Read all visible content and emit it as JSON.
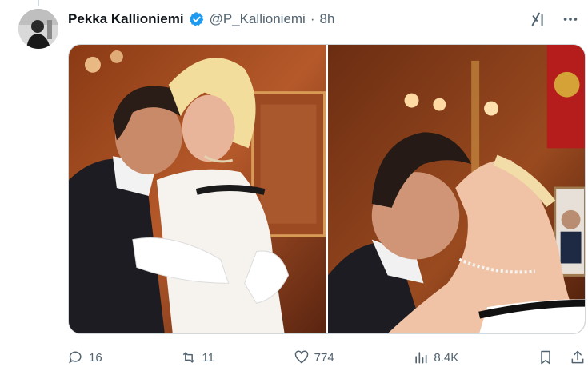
{
  "tweet": {
    "author_name": "Pekka Kallioniemi",
    "handle": "@P_Kallioniemi",
    "separator": "·",
    "time": "8h"
  },
  "stats": {
    "replies": "16",
    "retweets": "11",
    "likes": "774",
    "views": "8.4K"
  },
  "colors": {
    "verified": "#1d9bf0",
    "secondary_text": "#536471",
    "primary_text": "#0f1419"
  },
  "icons": [
    "grok-icon",
    "more-icon",
    "reply-icon",
    "retweet-icon",
    "like-icon",
    "views-icon",
    "bookmark-icon",
    "share-icon"
  ]
}
